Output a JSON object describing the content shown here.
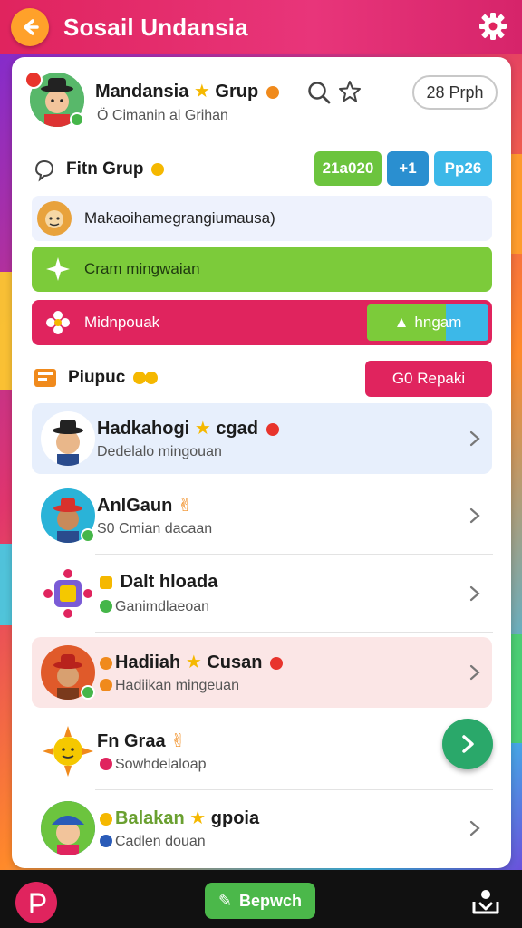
{
  "header": {
    "title": "Sosail Undansia",
    "back_icon": "back-arrow-icon",
    "settings_icon": "gear-icon"
  },
  "group": {
    "name": "Mandansia",
    "name_suffix": "Grup",
    "subtitle": "Ö Cimanin al Grihan",
    "members_button": "28 Prph"
  },
  "fitur": {
    "label": "Fitn Grup",
    "chips": [
      "21a020",
      "+1",
      "Pp26"
    ]
  },
  "banners": {
    "info_text": "Makaoihamegrangiumausa)",
    "green_text": "Cram mingwaian",
    "pink_text": "Midnpouak",
    "pink_button": "hngam"
  },
  "pinned": {
    "label": "Piupuc",
    "button": "G0 Repaki"
  },
  "items": [
    {
      "title": "Hadkahogi",
      "title_suffix": "cgad",
      "subtitle": "Dedelalo mingouan",
      "bg": "#e7effc"
    },
    {
      "title": "AnlGaun",
      "title_suffix": "",
      "subtitle": "S0 Cmian dacaan",
      "bg": "#ffffff"
    },
    {
      "title": "Dalt hloada",
      "title_suffix": "",
      "subtitle": "Ganimdlaeoan",
      "bg": "#ffffff"
    },
    {
      "title": "Hadiiah",
      "title_suffix": "Cusan",
      "subtitle": "Hadiikan mingeuan",
      "bg": "#fbe6e6"
    },
    {
      "title": "Fn Graa",
      "title_suffix": "",
      "subtitle": "Sowhdelaloap",
      "bg": "#ffffff"
    },
    {
      "title": "Balakan",
      "title_suffix": "gpoia",
      "subtitle": "Cadlen douan",
      "bg": "#ffffff"
    }
  ],
  "bottom": {
    "main_button": "Bepwch",
    "left_icon": "p-logo-icon",
    "right_icon": "inbox-icon"
  },
  "colors": {
    "header": "#e0245e",
    "accent_green": "#4bb84a",
    "accent_blue": "#2aa3d8",
    "accent_pink": "#e0245e"
  }
}
